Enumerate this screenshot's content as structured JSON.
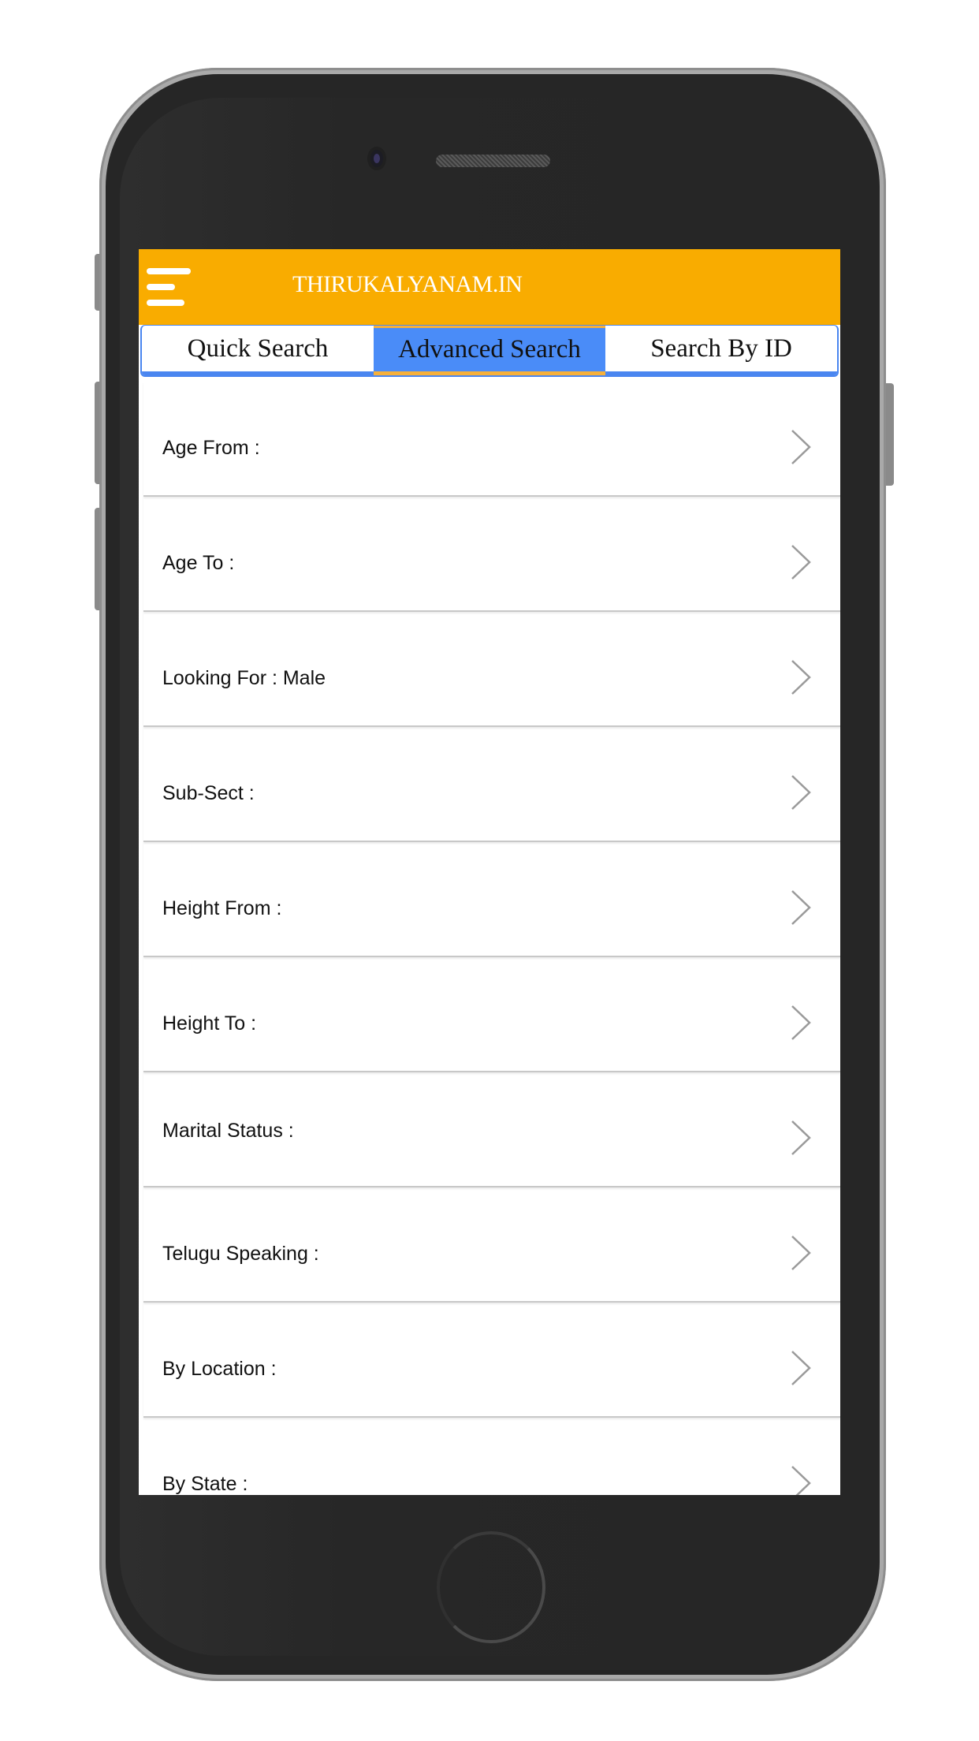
{
  "app": {
    "title": "THIRUKALYANAM.IN",
    "menu_icon": "hamburger-menu-icon",
    "colors": {
      "header": "#f9ac00",
      "tab_active": "#4a8cf8",
      "tab_border": "#4a86f0",
      "tab_active_underline": "#f6b03a"
    }
  },
  "tabs": [
    {
      "label": "Quick Search",
      "active": false
    },
    {
      "label": "Advanced Search",
      "active": true
    },
    {
      "label": "Search By ID",
      "active": false
    }
  ],
  "filters": [
    {
      "label": "Age From :",
      "icon": "chevron-right-icon"
    },
    {
      "label": "Age To :",
      "icon": "chevron-right-icon"
    },
    {
      "label": "Looking For : Male",
      "icon": "chevron-right-icon"
    },
    {
      "label": "Sub-Sect :",
      "icon": "chevron-right-icon"
    },
    {
      "label": "Height From :",
      "icon": "chevron-right-icon"
    },
    {
      "label": "Height To :",
      "icon": "chevron-right-icon"
    },
    {
      "label": "Marital Status :",
      "icon": "chevron-right-icon"
    },
    {
      "label": "Telugu Speaking :",
      "icon": "chevron-right-icon"
    },
    {
      "label": "By Location :",
      "icon": "chevron-right-icon"
    },
    {
      "label": "By State :",
      "icon": "chevron-right-icon"
    }
  ]
}
